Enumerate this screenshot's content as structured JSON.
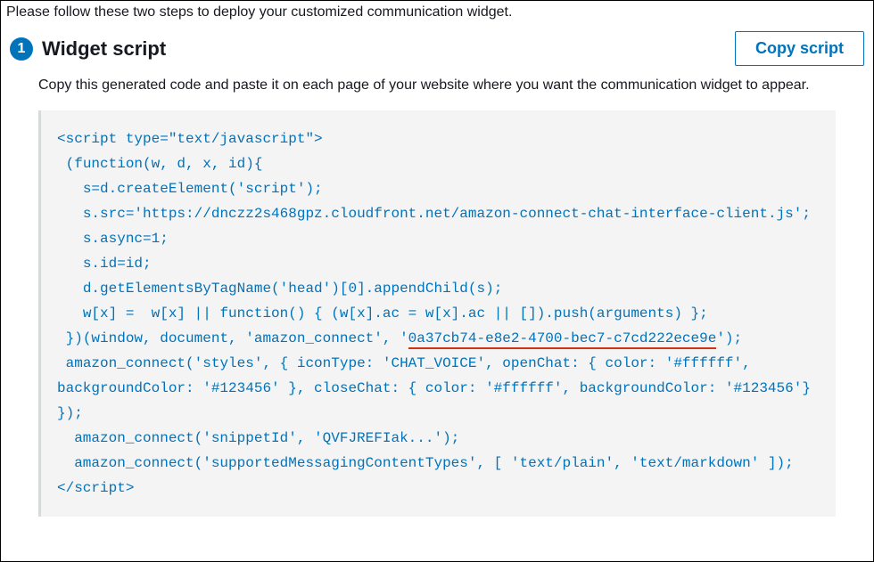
{
  "intro": "Please follow these two steps to deploy your customized communication widget.",
  "step": {
    "number": "1",
    "title": "Widget script",
    "copy_button": "Copy script",
    "description": "Copy this generated code and paste it on each page of your website where you want the communication widget to appear."
  },
  "code": {
    "line1": "<script type=\"text/javascript\">",
    "line2": " (function(w, d, x, id){",
    "line3": "   s=d.createElement('script');",
    "line4": "   s.src='https://dnczz2s468gpz.cloudfront.net/amazon-connect-chat-interface-client.js';",
    "line5": "   s.async=1;",
    "line6": "   s.id=id;",
    "line7": "   d.getElementsByTagName('head')[0].appendChild(s);",
    "line8": "   w[x] =  w[x] || function() { (w[x].ac = w[x].ac || []).push(arguments) };",
    "line9a": " })(window, document, 'amazon_connect', '",
    "uid": "0a37cb74-e8e2-4700-bec7-c7cd222ece9e",
    "line9b": "');",
    "line10": " amazon_connect('styles', { iconType: 'CHAT_VOICE', openChat: { color: '#ffffff', backgroundColor: '#123456' }, closeChat: { color: '#ffffff', backgroundColor: '#123456'} });",
    "line11": "  amazon_connect('snippetId', 'QVFJREFIak...');",
    "line12": "  amazon_connect('supportedMessagingContentTypes', [ 'text/plain', 'text/markdown' ]);",
    "line13": "</script>"
  }
}
